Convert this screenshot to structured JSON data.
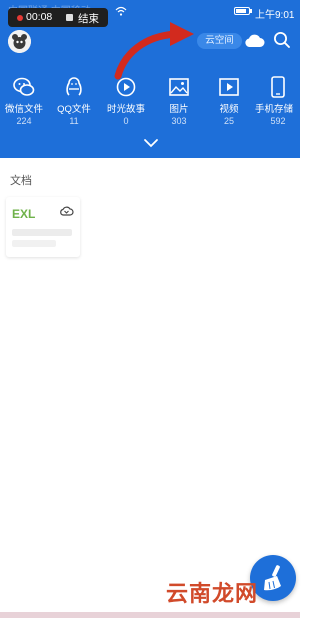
{
  "status_bar": {
    "ghost_text": "中国联通 中国移动",
    "record_time": "00:08",
    "record_end_label": "结束",
    "clock": "上午9:01"
  },
  "header": {
    "cloud_space_label": "云空间"
  },
  "categories": [
    {
      "label": "微信文件",
      "count": "224",
      "icon": "wechat-icon"
    },
    {
      "label": "QQ文件",
      "count": "11",
      "icon": "qq-icon"
    },
    {
      "label": "时光故事",
      "count": "0",
      "icon": "story-icon"
    },
    {
      "label": "图片",
      "count": "303",
      "icon": "image-icon"
    },
    {
      "label": "视频",
      "count": "25",
      "icon": "video-icon"
    },
    {
      "label": "手机存储",
      "count": "592",
      "icon": "phone-storage-icon"
    }
  ],
  "section": {
    "title": "文档"
  },
  "document": {
    "extension": "EXL"
  },
  "watermark": "云南龙网",
  "colors": {
    "primary": "#1e6fd9",
    "doc_ext": "#6fb24a",
    "arrow": "#d22a1e"
  }
}
